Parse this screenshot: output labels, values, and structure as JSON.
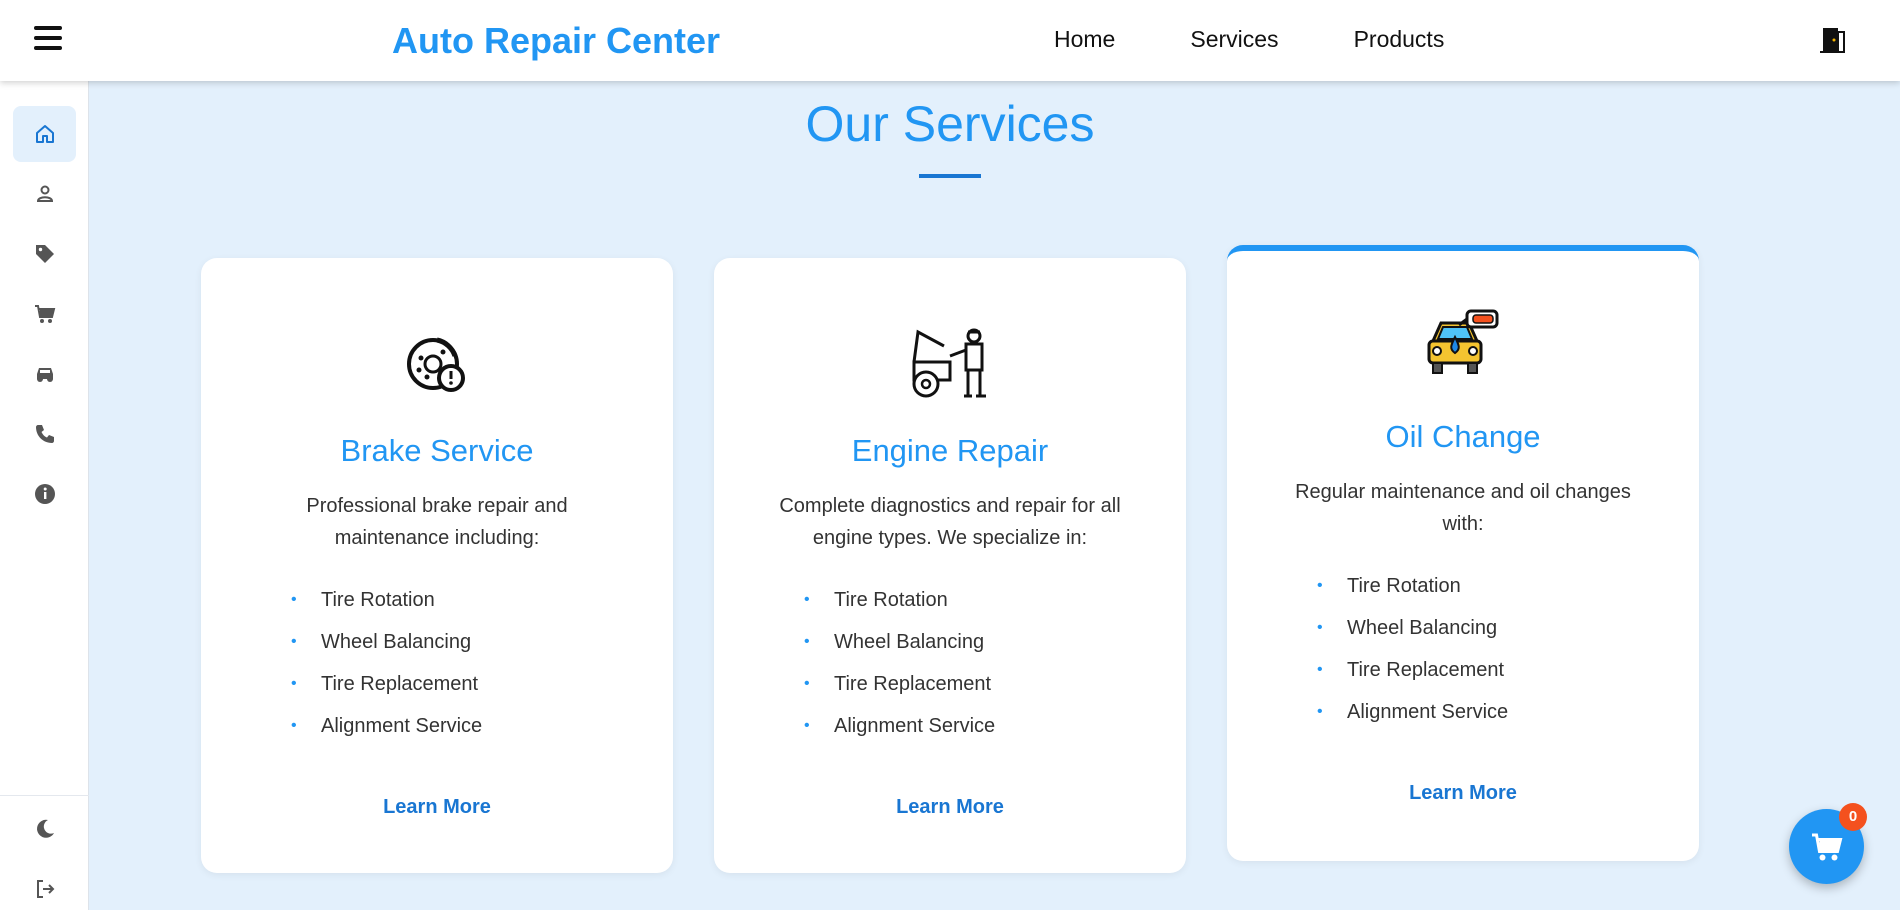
{
  "header": {
    "brand": "Auto Repair Center",
    "nav": [
      "Home",
      "Services",
      "Products"
    ]
  },
  "sidebar": {
    "items": [
      {
        "icon": "home-icon",
        "active": true
      },
      {
        "icon": "user-icon"
      },
      {
        "icon": "tag-icon"
      },
      {
        "icon": "cart-icon"
      },
      {
        "icon": "car-icon"
      },
      {
        "icon": "phone-icon"
      },
      {
        "icon": "info-icon"
      }
    ],
    "bottom": [
      {
        "icon": "moon-icon"
      },
      {
        "icon": "logout-icon"
      }
    ]
  },
  "section": {
    "title": "Our Services"
  },
  "cards": [
    {
      "title": "Brake Service",
      "desc": "Professional brake repair and maintenance including:",
      "items": [
        "Tire Rotation",
        "Wheel Balancing",
        "Tire Replacement",
        "Alignment Service"
      ],
      "cta": "Learn More",
      "icon": "brake-disc-icon"
    },
    {
      "title": "Engine Repair",
      "desc": "Complete diagnostics and repair for all engine types. We specialize in:",
      "items": [
        "Tire Rotation",
        "Wheel Balancing",
        "Tire Replacement",
        "Alignment Service"
      ],
      "cta": "Learn More",
      "icon": "mechanic-icon"
    },
    {
      "title": "Oil Change",
      "desc": "Regular maintenance and oil changes with:",
      "items": [
        "Tire Rotation",
        "Wheel Balancing",
        "Tire Replacement",
        "Alignment Service"
      ],
      "cta": "Learn More",
      "icon": "oil-car-icon"
    }
  ],
  "cart": {
    "count": "0"
  },
  "colors": {
    "accent": "#2196f3",
    "accent_dark": "#1976d2",
    "badge": "#f4511e",
    "background": "#e3f0fc"
  }
}
